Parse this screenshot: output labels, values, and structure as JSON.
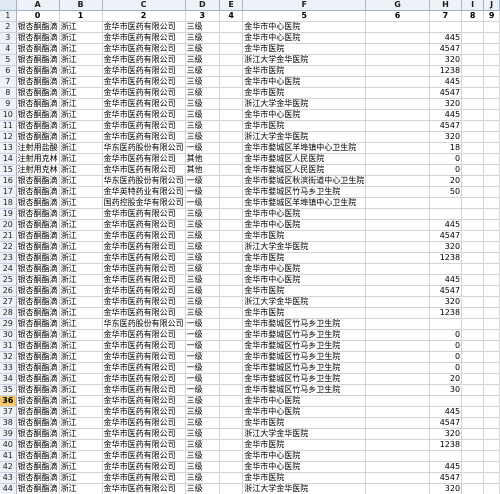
{
  "columns": [
    "0",
    "1",
    "2",
    "3",
    "4",
    "5",
    "6",
    "7",
    "8",
    "9"
  ],
  "active_row": 36,
  "rows": [
    {
      "n": "1",
      "cells": [
        "0",
        "1",
        "2",
        "3",
        "4",
        "5",
        "6",
        "7",
        "8",
        "9"
      ],
      "header": true
    },
    {
      "n": "2",
      "cells": [
        "银杏酮酯滴",
        "浙江",
        "金华市医药有限公司",
        "三级",
        "",
        "金华市中心医院",
        "",
        "",
        "",
        ""
      ]
    },
    {
      "n": "3",
      "cells": [
        "银杏酮酯滴",
        "浙江",
        "金华市医药有限公司",
        "三级",
        "",
        "金华市中心医院",
        "",
        "445",
        "",
        ""
      ]
    },
    {
      "n": "4",
      "cells": [
        "银杏酮酯滴",
        "浙江",
        "金华市医药有限公司",
        "三级",
        "",
        "金华市医院",
        "",
        "4547",
        "",
        ""
      ]
    },
    {
      "n": "5",
      "cells": [
        "银杏酮酯滴",
        "浙江",
        "金华市医药有限公司",
        "三级",
        "",
        "浙江大学金华医院",
        "",
        "320",
        "",
        ""
      ]
    },
    {
      "n": "6",
      "cells": [
        "银杏酮酯滴",
        "浙江",
        "金华市医药有限公司",
        "三级",
        "",
        "金华市医院",
        "",
        "1238",
        "",
        ""
      ]
    },
    {
      "n": "7",
      "cells": [
        "银杏酮酯滴",
        "浙江",
        "金华市医药有限公司",
        "三级",
        "",
        "金华市中心医院",
        "",
        "445",
        "",
        ""
      ]
    },
    {
      "n": "8",
      "cells": [
        "银杏酮酯滴",
        "浙江",
        "金华市医药有限公司",
        "三级",
        "",
        "金华市医院",
        "",
        "4547",
        "",
        ""
      ]
    },
    {
      "n": "9",
      "cells": [
        "银杏酮酯滴",
        "浙江",
        "金华市医药有限公司",
        "三级",
        "",
        "浙江大学金华医院",
        "",
        "320",
        "",
        ""
      ]
    },
    {
      "n": "10",
      "cells": [
        "银杏酮酯滴",
        "浙江",
        "金华市医药有限公司",
        "三级",
        "",
        "金华市中心医院",
        "",
        "445",
        "",
        ""
      ]
    },
    {
      "n": "11",
      "cells": [
        "银杏酮酯滴",
        "浙江",
        "金华市医药有限公司",
        "三级",
        "",
        "金华市医院",
        "",
        "4547",
        "",
        ""
      ]
    },
    {
      "n": "12",
      "cells": [
        "银杏酮酯滴",
        "浙江",
        "金华市医药有限公司",
        "三级",
        "",
        "浙江大学金华医院",
        "",
        "320",
        "",
        ""
      ]
    },
    {
      "n": "13",
      "cells": [
        "注射用盐酸",
        "浙江",
        "华东医药股份有限公司",
        "一级",
        "",
        "金华市婺城区羊埠镇中心卫生院",
        "",
        "18",
        "",
        ""
      ]
    },
    {
      "n": "14",
      "cells": [
        "注射用克林",
        "浙江",
        "金华市医药有限公司",
        "其他",
        "",
        "金华市婺城区人民医院",
        "",
        "0",
        "",
        ""
      ]
    },
    {
      "n": "15",
      "cells": [
        "注射用克林",
        "浙江",
        "金华市医药有限公司",
        "其他",
        "",
        "金华市婺城区人民医院",
        "",
        "0",
        "",
        ""
      ]
    },
    {
      "n": "16",
      "cells": [
        "银杏酮酯滴",
        "浙江",
        "华东医药股份有限公司",
        "一级",
        "",
        "金华市婺城区秋滨街道中心卫生院",
        "",
        "20",
        "",
        ""
      ]
    },
    {
      "n": "17",
      "cells": [
        "银杏酮酯滴",
        "浙江",
        "金华英特药业有限公司",
        "一级",
        "",
        "金华市婺城区竹马乡卫生院",
        "",
        "50",
        "",
        ""
      ]
    },
    {
      "n": "18",
      "cells": [
        "银杏酮酯滴",
        "浙江",
        "国药控股金华有限公司",
        "一级",
        "",
        "金华市婺城区羊埠镇中心卫生院",
        "",
        "",
        "",
        ""
      ]
    },
    {
      "n": "19",
      "cells": [
        "银杏酮酯滴",
        "浙江",
        "金华市医药有限公司",
        "三级",
        "",
        "金华市中心医院",
        "",
        "",
        "",
        ""
      ]
    },
    {
      "n": "20",
      "cells": [
        "银杏酮酯滴",
        "浙江",
        "金华市医药有限公司",
        "三级",
        "",
        "金华市中心医院",
        "",
        "445",
        "",
        ""
      ]
    },
    {
      "n": "21",
      "cells": [
        "银杏酮酯滴",
        "浙江",
        "金华市医药有限公司",
        "三级",
        "",
        "金华市医院",
        "",
        "4547",
        "",
        ""
      ]
    },
    {
      "n": "22",
      "cells": [
        "银杏酮酯滴",
        "浙江",
        "金华市医药有限公司",
        "三级",
        "",
        "浙江大学金华医院",
        "",
        "320",
        "",
        ""
      ]
    },
    {
      "n": "23",
      "cells": [
        "银杏酮酯滴",
        "浙江",
        "金华市医药有限公司",
        "三级",
        "",
        "金华市医院",
        "",
        "1238",
        "",
        ""
      ]
    },
    {
      "n": "24",
      "cells": [
        "银杏酮酯滴",
        "浙江",
        "金华市医药有限公司",
        "三级",
        "",
        "金华市中心医院",
        "",
        "",
        "",
        ""
      ]
    },
    {
      "n": "25",
      "cells": [
        "银杏酮酯滴",
        "浙江",
        "金华市医药有限公司",
        "三级",
        "",
        "金华市中心医院",
        "",
        "445",
        "",
        ""
      ]
    },
    {
      "n": "26",
      "cells": [
        "银杏酮酯滴",
        "浙江",
        "金华市医药有限公司",
        "三级",
        "",
        "金华市医院",
        "",
        "4547",
        "",
        ""
      ]
    },
    {
      "n": "27",
      "cells": [
        "银杏酮酯滴",
        "浙江",
        "金华市医药有限公司",
        "三级",
        "",
        "浙江大学金华医院",
        "",
        "320",
        "",
        ""
      ]
    },
    {
      "n": "28",
      "cells": [
        "银杏酮酯滴",
        "浙江",
        "金华市医药有限公司",
        "三级",
        "",
        "金华市医院",
        "",
        "1238",
        "",
        ""
      ]
    },
    {
      "n": "29",
      "cells": [
        "银杏酮酯滴",
        "浙江",
        "华东医药股份有限公司",
        "一级",
        "",
        "金华市婺城区竹马乡卫生院",
        "",
        "",
        "",
        ""
      ]
    },
    {
      "n": "30",
      "cells": [
        "银杏酮酯滴",
        "浙江",
        "金华市医药有限公司",
        "一级",
        "",
        "金华市婺城区竹马乡卫生院",
        "",
        "0",
        "",
        ""
      ]
    },
    {
      "n": "31",
      "cells": [
        "银杏酮酯滴",
        "浙江",
        "金华市医药有限公司",
        "一级",
        "",
        "金华市婺城区竹马乡卫生院",
        "",
        "0",
        "",
        ""
      ]
    },
    {
      "n": "32",
      "cells": [
        "银杏酮酯滴",
        "浙江",
        "金华市医药有限公司",
        "一级",
        "",
        "金华市婺城区竹马乡卫生院",
        "",
        "0",
        "",
        ""
      ]
    },
    {
      "n": "33",
      "cells": [
        "银杏酮酯滴",
        "浙江",
        "金华市医药有限公司",
        "一级",
        "",
        "金华市婺城区竹马乡卫生院",
        "",
        "0",
        "",
        ""
      ]
    },
    {
      "n": "34",
      "cells": [
        "银杏酮酯滴",
        "浙江",
        "金华市医药有限公司",
        "一级",
        "",
        "金华市婺城区竹马乡卫生院",
        "",
        "20",
        "",
        ""
      ]
    },
    {
      "n": "35",
      "cells": [
        "银杏酮酯滴",
        "浙江",
        "金华市医药有限公司",
        "一级",
        "",
        "金华市婺城区竹马乡卫生院",
        "",
        "30",
        "",
        ""
      ]
    },
    {
      "n": "36",
      "cells": [
        "银杏酮酯滴",
        "浙江",
        "金华市医药有限公司",
        "三级",
        "",
        "金华市中心医院",
        "",
        "",
        "",
        ""
      ]
    },
    {
      "n": "37",
      "cells": [
        "银杏酮酯滴",
        "浙江",
        "金华市医药有限公司",
        "三级",
        "",
        "金华市中心医院",
        "",
        "445",
        "",
        ""
      ]
    },
    {
      "n": "38",
      "cells": [
        "银杏酮酯滴",
        "浙江",
        "金华市医药有限公司",
        "三级",
        "",
        "金华市医院",
        "",
        "4547",
        "",
        ""
      ]
    },
    {
      "n": "39",
      "cells": [
        "银杏酮酯滴",
        "浙江",
        "金华市医药有限公司",
        "三级",
        "",
        "浙江大学金华医院",
        "",
        "320",
        "",
        ""
      ]
    },
    {
      "n": "40",
      "cells": [
        "银杏酮酯滴",
        "浙江",
        "金华市医药有限公司",
        "三级",
        "",
        "金华市医院",
        "",
        "1238",
        "",
        ""
      ]
    },
    {
      "n": "41",
      "cells": [
        "银杏酮酯滴",
        "浙江",
        "金华市医药有限公司",
        "三级",
        "",
        "金华市中心医院",
        "",
        "",
        "",
        ""
      ]
    },
    {
      "n": "42",
      "cells": [
        "银杏酮酯滴",
        "浙江",
        "金华市医药有限公司",
        "三级",
        "",
        "金华市中心医院",
        "",
        "445",
        "",
        ""
      ]
    },
    {
      "n": "43",
      "cells": [
        "银杏酮酯滴",
        "浙江",
        "金华市医药有限公司",
        "三级",
        "",
        "金华市医院",
        "",
        "4547",
        "",
        ""
      ]
    },
    {
      "n": "44",
      "cells": [
        "银杏酮酯滴",
        "浙江",
        "金华市医药有限公司",
        "三级",
        "",
        "浙江大学金华医院",
        "",
        "320",
        "",
        ""
      ]
    },
    {
      "n": "45",
      "cells": [
        "银杏酮酯滴",
        "浙江",
        "金华市医药有限公司",
        "三级",
        "",
        "金华市医院",
        "",
        "1238",
        "",
        ""
      ]
    }
  ]
}
